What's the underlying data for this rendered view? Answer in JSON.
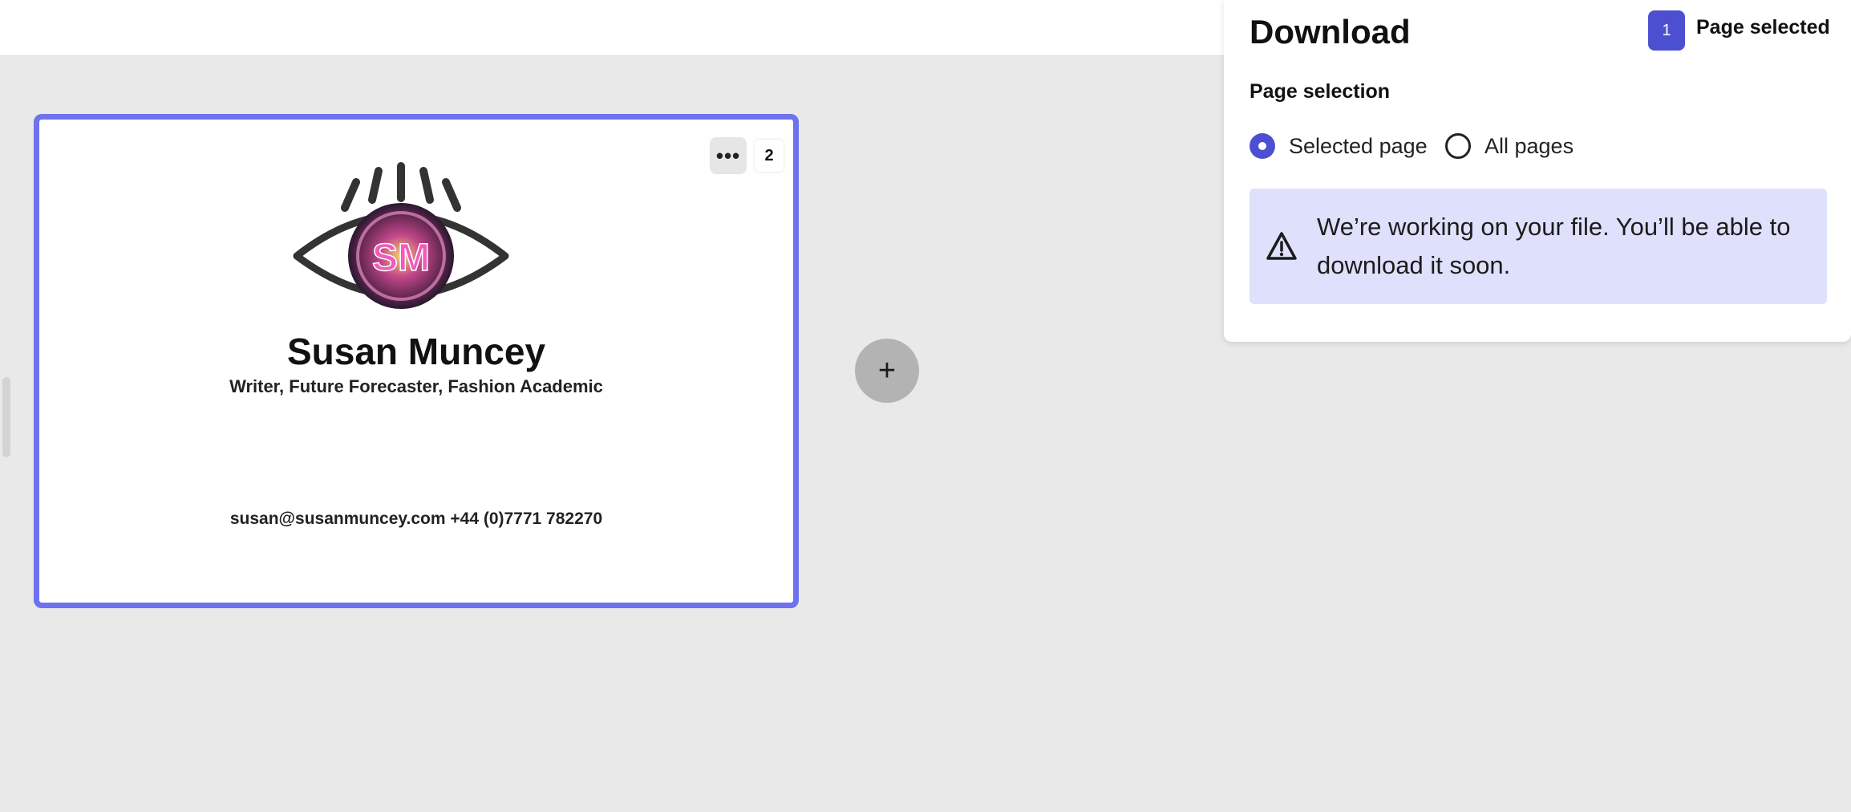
{
  "card": {
    "more_label": "•••",
    "page_number": "2",
    "logo_initials": "SM",
    "name": "Susan Muncey",
    "tagline": "Writer, Future Forecaster, Fashion Academic",
    "contact": "susan@susanmuncey.com +44 (0)7771 782270"
  },
  "add_page": {
    "label": "+"
  },
  "download_panel": {
    "title": "Download",
    "badge_count": "1",
    "badge_label": "Page selected",
    "section_label": "Page selection",
    "options": [
      {
        "label": "Selected page",
        "selected": true
      },
      {
        "label": "All pages",
        "selected": false
      }
    ],
    "notice": "We’re working on your file. You’ll be able to download it soon."
  },
  "colors": {
    "accent": "#4d4fd1",
    "selection_border": "#6f72ee",
    "notice_bg": "#dfe0fb"
  }
}
